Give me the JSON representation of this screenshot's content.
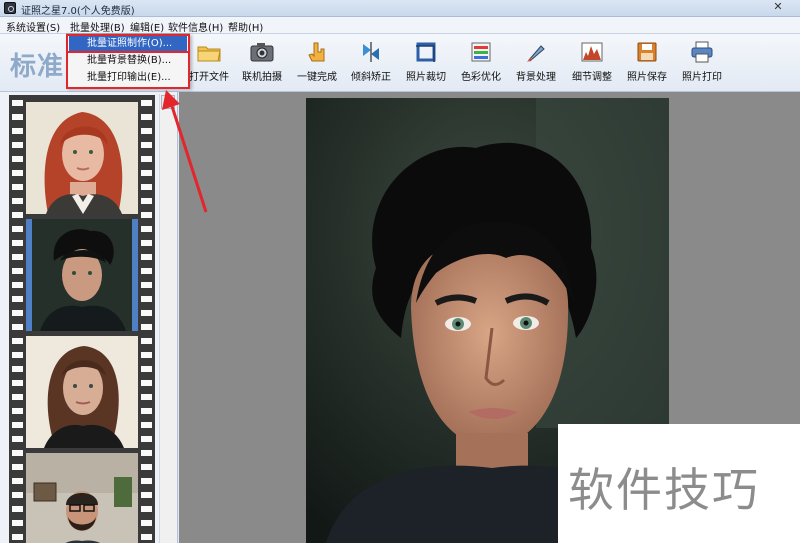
{
  "window": {
    "title": "证照之星7.0(个人免费版)",
    "close": "✕"
  },
  "menubar": {
    "items": [
      "系统设置(S)",
      "批量处理(B)",
      "编辑(E)",
      "软件信息(H)",
      "帮助(H)"
    ]
  },
  "dropdown": {
    "items": [
      "批量证照制作(O)...",
      "批量背景替换(B)...",
      "批量打印输出(E)..."
    ],
    "selected_index": 0
  },
  "toolbar": {
    "brand": "标准",
    "tools": [
      "打开文件",
      "联机拍摄",
      "一键完成",
      "倾斜矫正",
      "照片裁切",
      "色彩优化",
      "背景处理",
      "细节调整",
      "照片保存",
      "照片打印"
    ]
  },
  "filmstrip": {
    "thumbnails": [
      "red-haired-woman-portrait",
      "young-man-portrait",
      "brown-haired-woman-portrait",
      "bearded-man-portrait"
    ],
    "selected_index": 1
  },
  "canvas": {
    "photo": "young-man-dark-curly-hair-portrait"
  },
  "watermark": {
    "text": "软件技巧"
  },
  "colors": {
    "highlight": "#e2262b",
    "selection": "#3166c2",
    "brand": "#8ea9c9"
  }
}
